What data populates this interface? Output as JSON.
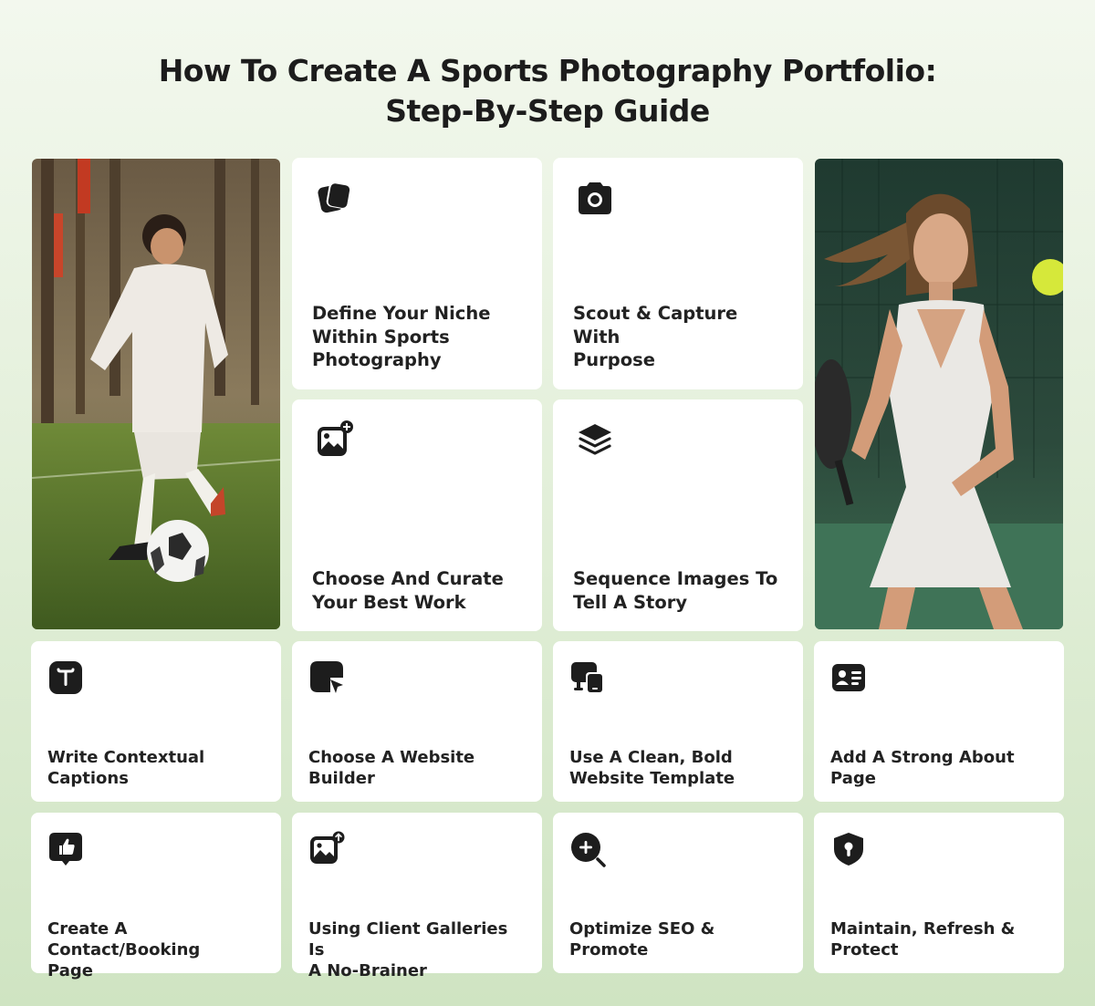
{
  "title": {
    "line1": "How To Create A Sports Photography Portfolio:",
    "line2": "Step-By-Step Guide"
  },
  "photos": {
    "left": "soccer-player-photo",
    "right": "tennis-player-photo"
  },
  "steps": [
    {
      "label_lines": [
        "Define Your Niche",
        "Within Sports",
        "Photography"
      ],
      "icon": "cards-stack-icon"
    },
    {
      "label_lines": [
        "Scout & Capture With",
        "Purpose"
      ],
      "icon": "camera-icon"
    },
    {
      "label_lines": [
        "Choose And Curate",
        "Your Best Work"
      ],
      "icon": "image-add-icon"
    },
    {
      "label_lines": [
        "Sequence Images To",
        "Tell A Story"
      ],
      "icon": "layers-icon"
    },
    {
      "label_lines": [
        "Write Contextual",
        "Captions"
      ],
      "icon": "text-icon"
    },
    {
      "label_lines": [
        "Choose A Website",
        "Builder"
      ],
      "icon": "cursor-square-icon"
    },
    {
      "label_lines": [
        "Use A Clean, Bold",
        "Website Template"
      ],
      "icon": "devices-icon"
    },
    {
      "label_lines": [
        "Add A Strong About",
        "Page"
      ],
      "icon": "contact-card-icon"
    },
    {
      "label_lines": [
        "Create A Contact/Booking",
        "Page"
      ],
      "icon": "thumbs-up-chat-icon"
    },
    {
      "label_lines": [
        "Using Client Galleries Is",
        "A No-Brainer"
      ],
      "icon": "image-upload-icon"
    },
    {
      "label_lines": [
        "Optimize SEO & Promote"
      ],
      "icon": "zoom-in-icon"
    },
    {
      "label_lines": [
        "Maintain, Refresh &",
        "Protect"
      ],
      "icon": "shield-lock-icon"
    }
  ]
}
